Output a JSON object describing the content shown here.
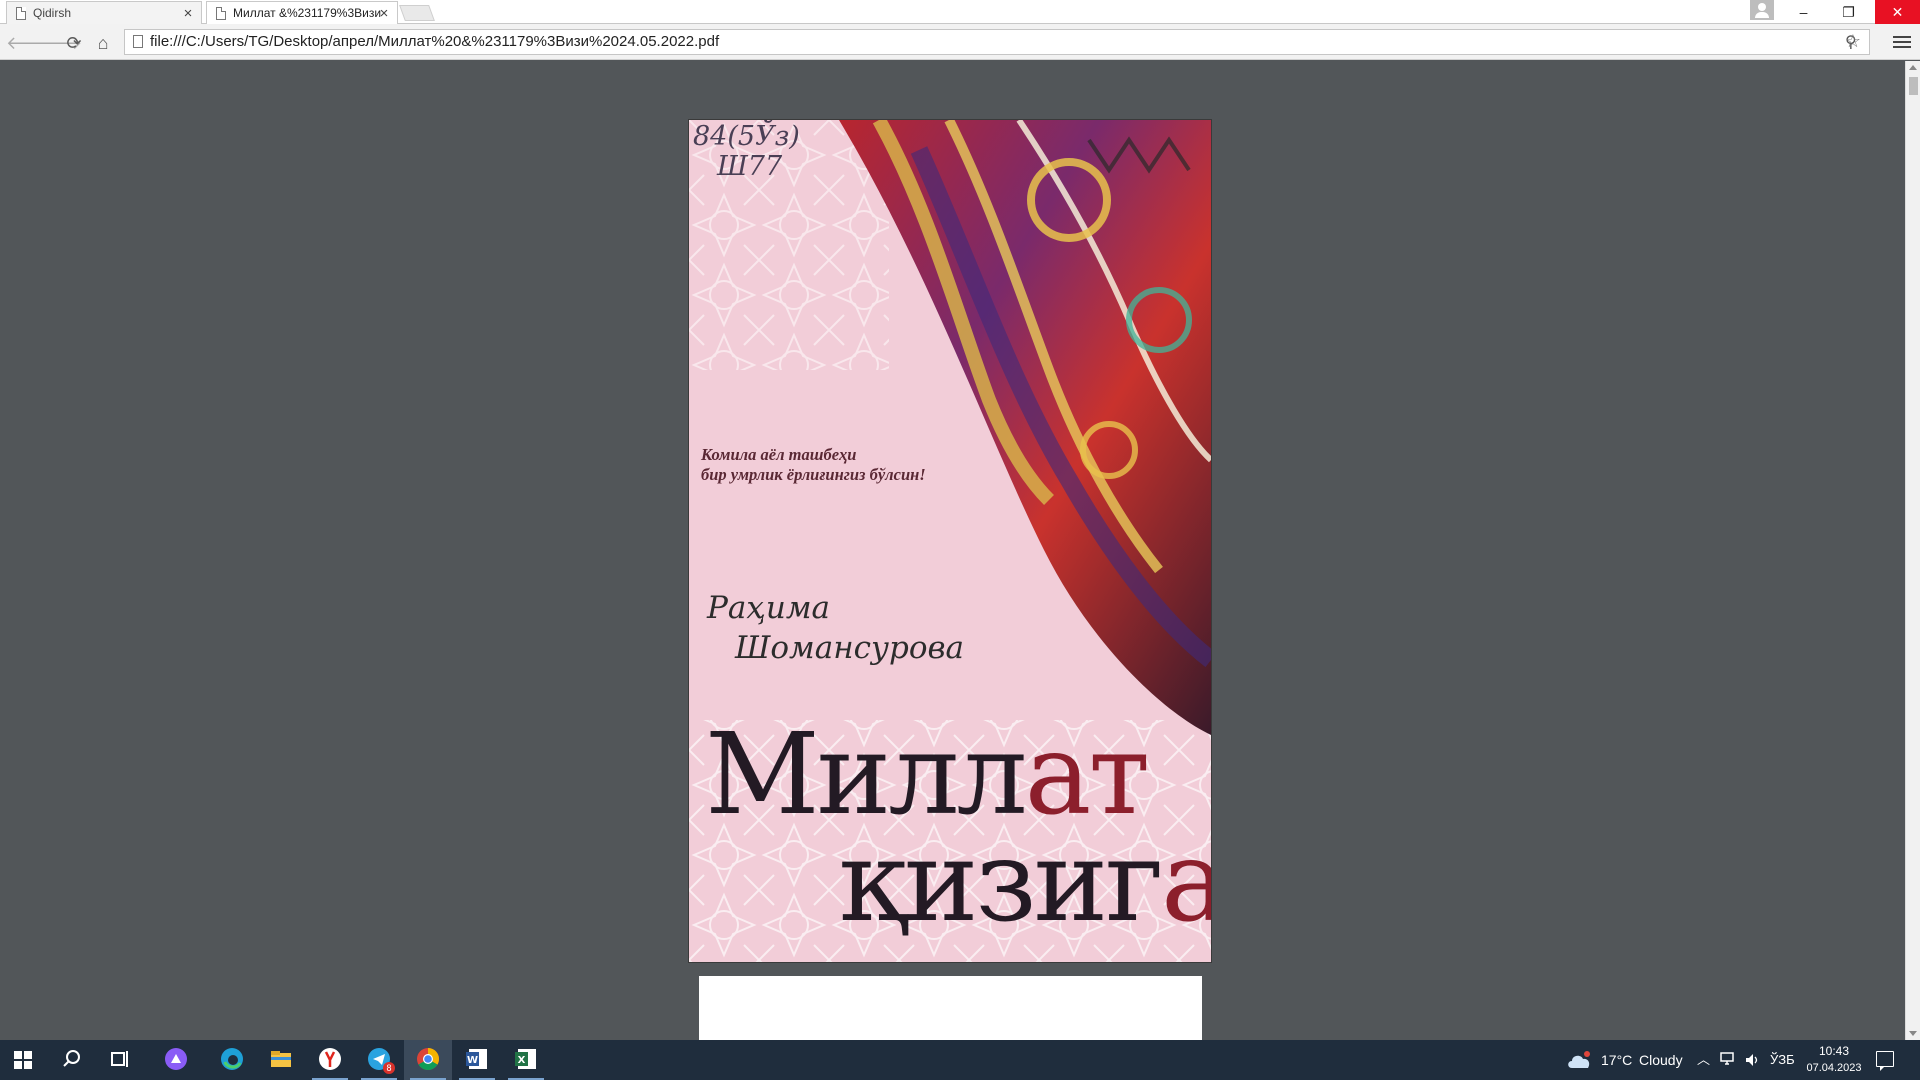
{
  "browser": {
    "tabs": [
      {
        "title": "Qidirsh",
        "active": false
      },
      {
        "title": "Миллат &%231179%3Визи",
        "active": true
      }
    ],
    "url": "file:///C:/Users/TG/Desktop/апрел/Миллат%20&%231179%3Визи%2024.05.2022.pdf",
    "window_controls": {
      "minimize": "–",
      "restore": "❐",
      "close": "✕"
    }
  },
  "cover": {
    "stamp_line1": "84(5Ўз)",
    "stamp_line2": "Ш77",
    "tagline_line1": "Комила аёл ташбеҳи",
    "tagline_line2": "бир умрлик ёрлиғингиз бўлсин!",
    "author_first": "Раҳима",
    "author_last": "Шомансурова",
    "title_line1_dark": "Милл",
    "title_line1_red": "ат",
    "title_line2_dark": "қизиг",
    "title_line2_red": "а",
    "colors": {
      "background": "#f2cdd8",
      "title_dark": "#231a24",
      "title_red": "#8c1f2c"
    }
  },
  "taskbar": {
    "apps": [
      "windows-start",
      "search",
      "task-view",
      "alice",
      "edge",
      "file-explorer",
      "yandex-browser",
      "telegram",
      "chrome",
      "word",
      "excel"
    ],
    "telegram_badge": "8",
    "weather_temp": "17°C",
    "weather_condition": "Cloudy",
    "language": "ЎЗБ",
    "time": "10:43",
    "date": "07.04.2023"
  }
}
